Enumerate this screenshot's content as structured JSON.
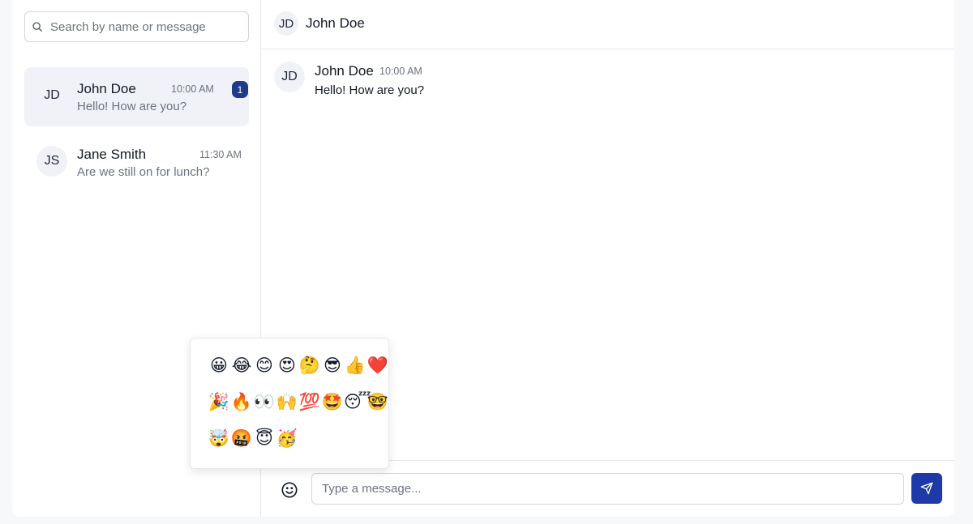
{
  "search": {
    "placeholder": "Search by name or message"
  },
  "conversations": [
    {
      "initials": "JD",
      "name": "John Doe",
      "time": "10:00 AM",
      "preview": "Hello! How are you?",
      "unread": "1"
    },
    {
      "initials": "JS",
      "name": "Jane Smith",
      "time": "11:30 AM",
      "preview": "Are we still on for lunch?"
    }
  ],
  "chat": {
    "header": {
      "initials": "JD",
      "name": "John Doe"
    },
    "messages": [
      {
        "initials": "JD",
        "sender": "John Doe",
        "time": "10:00 AM",
        "text": "Hello! How are you?"
      }
    ]
  },
  "composer": {
    "placeholder": "Type a message..."
  },
  "emoji_picker": {
    "emojis": [
      "😀",
      "😂",
      "😊",
      "😍",
      "🤔",
      "😎",
      "👍",
      "❤️",
      "🎉",
      "🔥",
      "👀",
      "🙌",
      "💯",
      "🤩",
      "😴",
      "🤓",
      "🤯",
      "🤬",
      "😇",
      "🥳"
    ]
  },
  "colors": {
    "accent": "#1e3aa8",
    "badge": "#1e3a8a",
    "active_row": "#f0f2f7"
  },
  "icons": {
    "search": "search-icon",
    "emoji": "smiley-icon",
    "send": "send-icon"
  }
}
